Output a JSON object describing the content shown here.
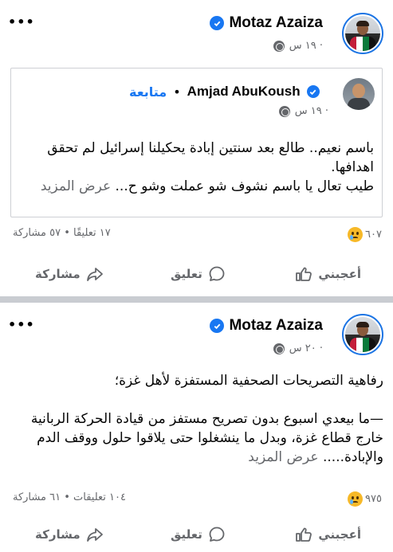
{
  "posts": [
    {
      "author": "Motaz Azaiza",
      "time": "١٩ س ·",
      "shared": {
        "author": "Amjad AbuKoush",
        "follow_label": "متابعة",
        "separator": "•",
        "time": "١٩ س ·",
        "lines": [
          "باسم نعيم.. طالع بعد سنتين إبادة يحكيلنا إسرائيل لم تحقق",
          "اهدافها.",
          "طيب تعال يا باسم نشوف شو عملت وشو ح..."
        ],
        "see_more": "عرض المزيد"
      },
      "reactions_count": "٦٠٧",
      "stats_text": "١٧ تعليقًا • ٥٧ مشاركة"
    },
    {
      "author": "Motaz Azaiza",
      "time": "٢٠ س ·",
      "lines": [
        "رفاهية التصريحات الصحفية المستفزة لأهل غزة؛",
        "",
        "—ما بيعدي اسبوع بدون تصريح مستفز من قيادة الحركة الربانية",
        "خارج قطاع غزة، وبدل ما ينشغلوا حتى يلاقوا حلول ووقف الدم",
        "والإبادة....."
      ],
      "see_more": "عرض المزيد",
      "reactions_count": "٩٧٥",
      "stats_text": "١٠٤ تعليقات • ٦١ مشاركة"
    }
  ],
  "actions": {
    "like": "أعجبني",
    "comment": "تعليق",
    "share": "مشاركة"
  },
  "icons": {
    "more": "more-dots-icon",
    "verified": "verified-badge-icon",
    "privacy": "globe-icon",
    "reaction": "sad-reaction-icon",
    "like": "thumbs-up-icon",
    "comment": "comment-bubble-icon",
    "share": "share-arrow-icon"
  },
  "colors": {
    "accent": "#1877f2",
    "secondary_text": "#65676b",
    "divider": "#c9ccd1"
  }
}
